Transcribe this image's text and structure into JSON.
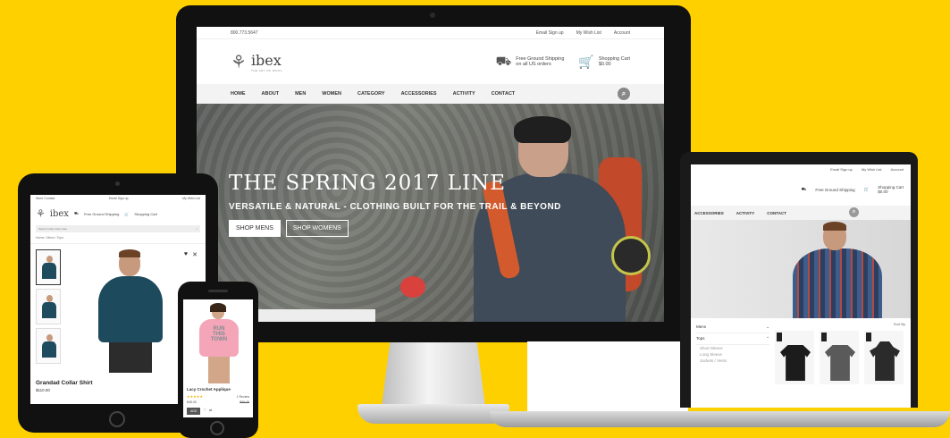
{
  "desktop": {
    "topbar": {
      "phone": "800.773.5647",
      "email": "Email Sign up",
      "wishlist": "My Wish List",
      "account": "Account"
    },
    "logo": {
      "name": "ibex",
      "tagline": "THE ART OF WOOL"
    },
    "shipping": {
      "line1": "Free Ground Shipping",
      "line2": "on all US orders"
    },
    "cart": {
      "label": "Shopping Cart",
      "amount": "$0.00",
      "count": "0"
    },
    "nav": [
      "HOME",
      "ABOUT",
      "MEN",
      "WOMEN",
      "CATEGORY",
      "ACCESSORIES",
      "ACTIVITY",
      "CONTACT"
    ],
    "hero": {
      "title": "THE SPRING 2017 LINE",
      "subtitle": "VERSATILE & NATURAL - CLOTHING BUILT FOR THE TRAIL & BEYOND",
      "btn_men": "SHOP MENS",
      "btn_women": "SHOP WOMENS"
    }
  },
  "laptop": {
    "topbar": {
      "email": "Email Sign up",
      "wishlist": "My Wish List",
      "account": "Account"
    },
    "shipping": "Free Ground Shipping",
    "cart": {
      "label": "Shopping Cart",
      "amount": "$0.00"
    },
    "nav": [
      "ACCESSORIES",
      "ACTIVITY",
      "CONTACT"
    ],
    "sidebar": {
      "section": "Mens",
      "category": "Tops",
      "subs": [
        "Short Sleeve",
        "Long Sleeve",
        "Jackets / Vests"
      ]
    },
    "sort_label": "Sort By",
    "tee_colors": [
      "#1c1c1c",
      "#5a5a5a",
      "#2b2b2b"
    ]
  },
  "tablet": {
    "topbar": {
      "left": "Store Contact",
      "email": "Email Sign up",
      "wishlist": "My Wish List"
    },
    "logo": {
      "name": "ibex"
    },
    "shipping": "Free Ground Shipping",
    "cart": "Shopping Cart",
    "search_placeholder": "Search entire store here",
    "breadcrumb": "Home / Mens / Tops",
    "product": {
      "title": "Grandad Collar Shirt",
      "price": "$110.00"
    }
  },
  "phone": {
    "tshirt_print": "RUN THIS TOWN",
    "product": {
      "title": "Lacy Crochet Applique",
      "price": "$48.45",
      "old_price": "$69.45",
      "reviews": "1 Review",
      "add": "ADD"
    }
  }
}
